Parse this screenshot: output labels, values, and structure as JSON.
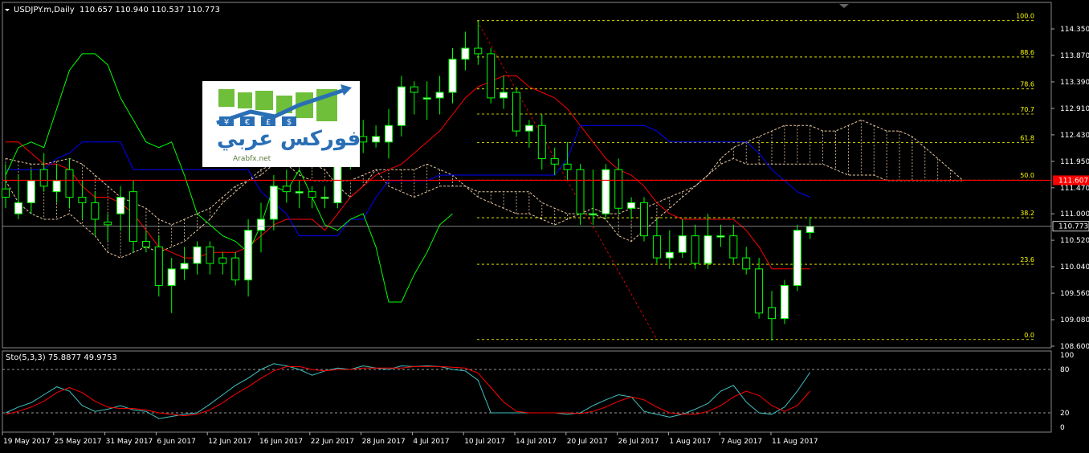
{
  "header": {
    "symbol": "USDJPY.m,Daily",
    "ohlc": "110.657 110.940 110.537 110.773"
  },
  "oscillator": {
    "label": "Sto(5,3,3) 75.8877 49.9753",
    "levels": [
      "100",
      "80",
      "20",
      "0"
    ]
  },
  "price_axis": {
    "labels": [
      "114.350",
      "113.870",
      "113.390",
      "112.910",
      "112.430",
      "111.950",
      "111.470",
      "111.000",
      "110.520",
      "110.040",
      "109.560",
      "109.080",
      "108.600"
    ],
    "current_price": "110.773",
    "marked_price": "111.607"
  },
  "fibonacci": {
    "levels": [
      "100.0",
      "88.6",
      "78.6",
      "70.7",
      "61.8",
      "50.0",
      "38.2",
      "23.6",
      "0.0"
    ]
  },
  "time_axis": {
    "labels": [
      "19 May 2017",
      "25 May 2017",
      "31 May 2017",
      "6 Jun 2017",
      "12 Jun 2017",
      "16 Jun 2017",
      "22 Jun 2017",
      "28 Jun 2017",
      "4 Jul 2017",
      "10 Jul 2017",
      "14 Jul 2017",
      "20 Jul 2017",
      "26 Jul 2017",
      "1 Aug 2017",
      "7 Aug 2017",
      "11 Aug 2017"
    ]
  },
  "logo": {
    "arabic_text": "فوركس عربي",
    "url_text": "Arabfx.net",
    "coin_letters": [
      "¥",
      "€",
      "£",
      "$"
    ]
  },
  "colors": {
    "background": "#000000",
    "bull_candle": "#ffffff",
    "bear_candle": "#000000",
    "wick": "#00ff00",
    "tenkan": "#ff0000",
    "kijun": "#0000ff",
    "chikou": "#00ff00",
    "cloud": "#e8c8a0",
    "fib": "#ffff00",
    "stoch_main": "#40c0c0",
    "stoch_signal": "#ff0000",
    "axis_text": "#ffffff"
  },
  "chart_data": {
    "type": "candlestick",
    "title": "USDJPY.m,Daily",
    "ylim": [
      108.6,
      114.5
    ],
    "candles": [
      {
        "o": 111.45,
        "h": 111.9,
        "l": 111.1,
        "c": 111.3
      },
      {
        "o": 111.0,
        "h": 111.7,
        "l": 110.9,
        "c": 111.2
      },
      {
        "o": 111.2,
        "h": 111.8,
        "l": 111.0,
        "c": 111.6
      },
      {
        "o": 111.8,
        "h": 112.1,
        "l": 111.4,
        "c": 111.5
      },
      {
        "o": 111.4,
        "h": 111.9,
        "l": 111.2,
        "c": 111.6
      },
      {
        "o": 111.8,
        "h": 112.0,
        "l": 111.1,
        "c": 111.3
      },
      {
        "o": 111.3,
        "h": 111.6,
        "l": 110.9,
        "c": 111.2
      },
      {
        "o": 111.2,
        "h": 111.4,
        "l": 110.6,
        "c": 110.9
      },
      {
        "o": 110.85,
        "h": 111.0,
        "l": 110.5,
        "c": 110.8
      },
      {
        "o": 111.0,
        "h": 111.5,
        "l": 110.7,
        "c": 111.3
      },
      {
        "o": 111.4,
        "h": 111.6,
        "l": 110.3,
        "c": 110.5
      },
      {
        "o": 110.5,
        "h": 110.7,
        "l": 110.3,
        "c": 110.4
      },
      {
        "o": 110.4,
        "h": 110.6,
        "l": 109.5,
        "c": 109.7
      },
      {
        "o": 109.7,
        "h": 110.2,
        "l": 109.2,
        "c": 110.0
      },
      {
        "o": 110.0,
        "h": 110.4,
        "l": 109.8,
        "c": 110.1
      },
      {
        "o": 110.1,
        "h": 110.5,
        "l": 109.9,
        "c": 110.4
      },
      {
        "o": 110.4,
        "h": 110.5,
        "l": 109.9,
        "c": 110.1
      },
      {
        "o": 110.2,
        "h": 110.3,
        "l": 109.9,
        "c": 110.1
      },
      {
        "o": 110.2,
        "h": 110.3,
        "l": 109.7,
        "c": 109.8
      },
      {
        "o": 109.8,
        "h": 110.9,
        "l": 109.5,
        "c": 110.7
      },
      {
        "o": 110.7,
        "h": 111.2,
        "l": 110.3,
        "c": 110.9
      },
      {
        "o": 110.9,
        "h": 111.7,
        "l": 110.7,
        "c": 111.5
      },
      {
        "o": 111.5,
        "h": 111.8,
        "l": 111.2,
        "c": 111.4
      },
      {
        "o": 111.4,
        "h": 111.6,
        "l": 111.1,
        "c": 111.4
      },
      {
        "o": 111.4,
        "h": 111.5,
        "l": 111.1,
        "c": 111.3
      },
      {
        "o": 111.3,
        "h": 111.5,
        "l": 111.1,
        "c": 111.3
      },
      {
        "o": 111.2,
        "h": 112.0,
        "l": 111.1,
        "c": 111.9
      },
      {
        "o": 111.9,
        "h": 112.6,
        "l": 111.8,
        "c": 112.4
      },
      {
        "o": 112.4,
        "h": 112.7,
        "l": 112.1,
        "c": 112.3
      },
      {
        "o": 112.3,
        "h": 112.6,
        "l": 112.2,
        "c": 112.4
      },
      {
        "o": 112.3,
        "h": 112.9,
        "l": 112.0,
        "c": 112.6
      },
      {
        "o": 112.6,
        "h": 113.5,
        "l": 112.4,
        "c": 113.3
      },
      {
        "o": 113.3,
        "h": 113.4,
        "l": 112.8,
        "c": 113.2
      },
      {
        "o": 113.1,
        "h": 113.4,
        "l": 112.7,
        "c": 113.1
      },
      {
        "o": 113.1,
        "h": 113.5,
        "l": 112.8,
        "c": 113.2
      },
      {
        "o": 113.2,
        "h": 114.0,
        "l": 113.0,
        "c": 113.8
      },
      {
        "o": 113.8,
        "h": 114.3,
        "l": 113.6,
        "c": 114.0
      },
      {
        "o": 114.0,
        "h": 114.5,
        "l": 113.7,
        "c": 113.9
      },
      {
        "o": 113.9,
        "h": 114.0,
        "l": 113.0,
        "c": 113.1
      },
      {
        "o": 113.1,
        "h": 113.5,
        "l": 112.9,
        "c": 113.2
      },
      {
        "o": 113.2,
        "h": 113.3,
        "l": 112.4,
        "c": 112.5
      },
      {
        "o": 112.5,
        "h": 112.7,
        "l": 112.2,
        "c": 112.6
      },
      {
        "o": 112.6,
        "h": 112.8,
        "l": 111.8,
        "c": 112.0
      },
      {
        "o": 112.0,
        "h": 112.2,
        "l": 111.7,
        "c": 111.9
      },
      {
        "o": 111.9,
        "h": 112.3,
        "l": 111.6,
        "c": 111.8
      },
      {
        "o": 111.8,
        "h": 111.9,
        "l": 110.8,
        "c": 111.0
      },
      {
        "o": 111.0,
        "h": 111.8,
        "l": 110.8,
        "c": 111.0
      },
      {
        "o": 111.0,
        "h": 111.9,
        "l": 110.9,
        "c": 111.8
      },
      {
        "o": 111.8,
        "h": 112.0,
        "l": 111.0,
        "c": 111.1
      },
      {
        "o": 111.1,
        "h": 111.3,
        "l": 110.9,
        "c": 111.2
      },
      {
        "o": 111.2,
        "h": 111.3,
        "l": 110.5,
        "c": 110.6
      },
      {
        "o": 110.6,
        "h": 110.9,
        "l": 110.1,
        "c": 110.2
      },
      {
        "o": 110.2,
        "h": 110.7,
        "l": 110.0,
        "c": 110.3
      },
      {
        "o": 110.3,
        "h": 110.9,
        "l": 110.2,
        "c": 110.6
      },
      {
        "o": 110.6,
        "h": 110.8,
        "l": 110.0,
        "c": 110.1
      },
      {
        "o": 110.1,
        "h": 111.0,
        "l": 110.0,
        "c": 110.6
      },
      {
        "o": 110.6,
        "h": 110.8,
        "l": 110.4,
        "c": 110.6
      },
      {
        "o": 110.6,
        "h": 110.8,
        "l": 110.1,
        "c": 110.2
      },
      {
        "o": 110.2,
        "h": 110.4,
        "l": 109.9,
        "c": 110.0
      },
      {
        "o": 110.0,
        "h": 110.2,
        "l": 109.1,
        "c": 109.2
      },
      {
        "o": 109.3,
        "h": 109.6,
        "l": 108.7,
        "c": 109.1
      },
      {
        "o": 109.1,
        "h": 109.8,
        "l": 109.0,
        "c": 109.7
      },
      {
        "o": 109.7,
        "h": 110.8,
        "l": 109.6,
        "c": 110.7
      },
      {
        "o": 110.66,
        "h": 110.94,
        "l": 110.54,
        "c": 110.77
      }
    ],
    "stochastic": {
      "main": [
        20,
        28,
        34,
        45,
        56,
        50,
        30,
        22,
        25,
        30,
        24,
        22,
        12,
        15,
        18,
        20,
        32,
        45,
        58,
        68,
        80,
        88,
        85,
        80,
        72,
        78,
        82,
        80,
        85,
        82,
        80,
        85,
        84,
        85,
        84,
        80,
        78,
        65,
        20,
        20,
        20,
        20,
        20,
        20,
        18,
        20,
        30,
        38,
        45,
        42,
        22,
        18,
        14,
        18,
        25,
        33,
        50,
        58,
        35,
        20,
        18,
        28,
        50,
        76
      ],
      "signal": [
        18,
        22,
        28,
        36,
        48,
        55,
        48,
        36,
        28,
        26,
        26,
        24,
        20,
        18,
        16,
        18,
        24,
        34,
        46,
        56,
        68,
        78,
        84,
        84,
        80,
        78,
        80,
        80,
        82,
        82,
        82,
        82,
        84,
        84,
        84,
        83,
        82,
        75,
        55,
        35,
        22,
        20,
        20,
        20,
        20,
        19,
        22,
        28,
        36,
        42,
        38,
        28,
        20,
        18,
        18,
        22,
        30,
        42,
        50,
        44,
        30,
        22,
        30,
        50
      ]
    }
  }
}
